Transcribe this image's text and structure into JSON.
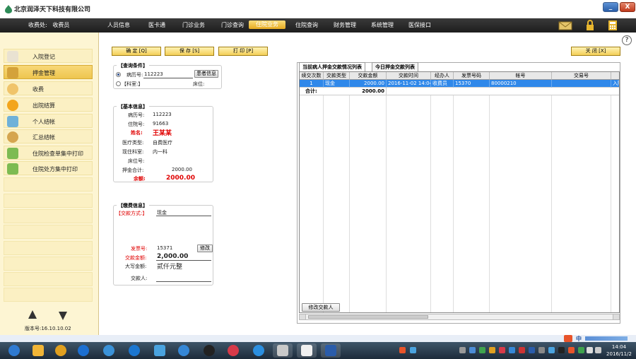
{
  "window": {
    "title": "北京润泽天下科技有限公司",
    "minimize": "_",
    "close": "X"
  },
  "menubar": {
    "cashier_label": "收费处:",
    "cashier_value": "收费员",
    "items": [
      "人员信息",
      "医卡通",
      "门诊业务",
      "门诊查询",
      "住院业务",
      "住院查询",
      "财务管理",
      "系统管理",
      "医保接口"
    ],
    "active_index": 4
  },
  "help": "?",
  "sidebar": {
    "items": [
      {
        "label": "入院登记",
        "icon": "admission-icon",
        "color": "#e9e2d2"
      },
      {
        "label": "押金管理",
        "icon": "deposit-icon",
        "color": "#d4a23a"
      },
      {
        "label": "收费",
        "icon": "charge-icon",
        "color": "#f0c46a"
      },
      {
        "label": "出院结算",
        "icon": "discharge-icon",
        "color": "#f3a51c"
      },
      {
        "label": "个人结帐",
        "icon": "calculator-icon",
        "color": "#6fb1d9"
      },
      {
        "label": "汇总结帐",
        "icon": "summary-icon",
        "color": "#d5a54f"
      },
      {
        "label": "住院检查单集中打印",
        "icon": "puzzle-icon",
        "color": "#7dbb52"
      },
      {
        "label": "住院处方集中打印",
        "icon": "puzzle-icon",
        "color": "#7dbb52"
      }
    ],
    "active_index": 1,
    "version": "版本号:16.10.10.02"
  },
  "actions": {
    "confirm": "确 定 [Q]",
    "save": "保 存 [S]",
    "print": "打 印 [P]",
    "close": "关 闭 [X]"
  },
  "query": {
    "title": "【查询条件】",
    "record_label": "病历号:",
    "record_value": "112223",
    "patient_info_btn": "患者信息",
    "dept_label": "【科室:】",
    "bed_label": "床位:"
  },
  "basic": {
    "title": "【基本信息】",
    "record_no_label": "病历号:",
    "record_no": "112223",
    "inpatient_no_label": "住院号:",
    "inpatient_no": "91663",
    "name_label": "姓名:",
    "name": "王某某",
    "med_type_label": "医疗类型:",
    "med_type": "自费医疗",
    "ward_label": "现住科室:",
    "ward": "内一科",
    "bed_label": "床位号:",
    "bed": "",
    "deposit_total_label": "押金合计:",
    "deposit_total": "2000.00",
    "balance_label": "余额:",
    "balance": "2000.00"
  },
  "payment": {
    "title": "【缴费信息】",
    "method_label": "【交款方式:】",
    "method": "现金",
    "invoice_label": "发票号:",
    "invoice": "15371",
    "modify_btn": "修改",
    "amount_label": "交款金额:",
    "amount": "2,000.00",
    "upper_label": "大写金额:",
    "upper": "贰仟元整",
    "payer_label": "交款人:"
  },
  "grid": {
    "tabs": [
      "当前病人押金交款情况列表",
      "今日押金交款列表"
    ],
    "active_tab": 0,
    "columns": [
      "续交次数",
      "交款类型",
      "交款金额",
      "交款时间",
      "经办人",
      "发票号码",
      "帐号",
      "交易号",
      ""
    ],
    "rows": [
      [
        "1",
        "现金",
        "2000.00",
        "2016-11-02 14:04",
        "收费员",
        "15370",
        "80000210",
        "",
        "入院"
      ]
    ],
    "total_label": "合计:",
    "total_value": "2000.00",
    "modify_payer_btn": "修改交款人"
  },
  "taskbar": {
    "time": "14:04",
    "date": "2016/11/2",
    "ime": "中",
    "apps": [
      {
        "name": "start-orb",
        "color": "#2f7ad1"
      },
      {
        "name": "app-folder",
        "color": "#f1b537"
      },
      {
        "name": "app-owl",
        "color": "#e0a020"
      },
      {
        "name": "app-k",
        "color": "#1c6fd1"
      },
      {
        "name": "app-globe",
        "color": "#3b92d8"
      },
      {
        "name": "app-sogou",
        "color": "#1b76d0"
      },
      {
        "name": "app-shield",
        "color": "#4aa3df"
      },
      {
        "name": "app-bird",
        "color": "#3587d6"
      },
      {
        "name": "app-qq",
        "color": "#222222"
      },
      {
        "name": "app-music",
        "color": "#d73a49"
      },
      {
        "name": "app-browser",
        "color": "#2b8fe0"
      },
      {
        "name": "app-tools",
        "color": "#c9c9c9"
      },
      {
        "name": "app-cards",
        "color": "#f0f0f0"
      },
      {
        "name": "app-word",
        "color": "#2a5caa"
      }
    ]
  }
}
